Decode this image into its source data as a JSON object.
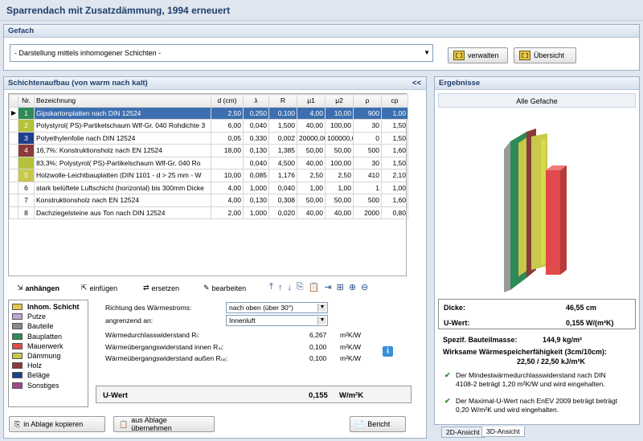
{
  "window": {
    "title": "Sparrendach mit Zusatzdämmung, 1994 erneuert"
  },
  "gefach": {
    "header": "Gefach",
    "dropdown_value": "- Darstellung mittels inhomogener Schichten -",
    "verwalten": "verwalten",
    "uebersicht": "Übersicht"
  },
  "schichten": {
    "header": "Schichtenaufbau (von warm nach kalt)",
    "collapse": "<<",
    "columns": [
      "Nr.",
      "Bezeichnung",
      "d (cm)",
      "λ",
      "R",
      "μ1",
      "μ2",
      "ρ",
      "cp"
    ],
    "rows": [
      {
        "nr": "1",
        "color": "#2e8b57",
        "name": "Gipskartonplatten nach DIN 12524",
        "d": "2,50",
        "l": "0,250",
        "r": "0,100",
        "m1": "4,00",
        "m2": "10,00",
        "rho": "900",
        "cp": "1,00"
      },
      {
        "nr": "2",
        "color": "#b5c23a",
        "name": "Polystyrol( PS)-Partikelschaum Wlf-Gr. 040 Rohdichte 3",
        "d": "6,00",
        "l": "0,040",
        "r": "1,500",
        "m1": "40,00",
        "m2": "100,00",
        "rho": "30",
        "cp": "1,50"
      },
      {
        "nr": "3",
        "color": "#1f3f8f",
        "name": "Polyethylenfolie nach DIN 12524",
        "d": "0,05",
        "l": "0,330",
        "r": "0,002",
        "m1": "20000,00",
        "m2": "100000,00",
        "rho": "0",
        "cp": "1,50"
      },
      {
        "nr": "4",
        "color": "#8b3a3a",
        "name": "16,7%: Konstruktionsholz nach EN 12524",
        "d": "18,00",
        "l": "0,130",
        "r": "1,385",
        "m1": "50,00",
        "m2": "50,00",
        "rho": "500",
        "cp": "1,60"
      },
      {
        "nr": "",
        "color": "#b5c23a",
        "name": "83,3%: Polystyrol( PS)-Partikelschaum Wlf-Gr. 040 Ro",
        "d": "",
        "l": "0,040",
        "r": "4,500",
        "m1": "40,00",
        "m2": "100,00",
        "rho": "30",
        "cp": "1,50"
      },
      {
        "nr": "5",
        "color": "#c8c84a",
        "name": "Holzwolle-Leichtbauplatten (DIN 1101 - d > 25 mm - W",
        "d": "10,00",
        "l": "0,085",
        "r": "1,176",
        "m1": "2,50",
        "m2": "2,50",
        "rho": "410",
        "cp": "2,10"
      },
      {
        "nr": "6",
        "color": "#ffffff",
        "name": "stark belüftete Luftschicht (horizontal) bis 300mm Dicke",
        "d": "4,00",
        "l": "1,000",
        "r": "0,040",
        "m1": "1,00",
        "m2": "1,00",
        "rho": "1",
        "cp": "1,00"
      },
      {
        "nr": "7",
        "color": "#ffffff",
        "name": "Konstruktionsholz nach EN 12524",
        "d": "4,00",
        "l": "0,130",
        "r": "0,308",
        "m1": "50,00",
        "m2": "50,00",
        "rho": "500",
        "cp": "1,60"
      },
      {
        "nr": "8",
        "color": "#ffffff",
        "name": "Dachziegelsteine aus Ton nach DIN 12524",
        "d": "2,00",
        "l": "1,000",
        "r": "0,020",
        "m1": "40,00",
        "m2": "40,00",
        "rho": "2000",
        "cp": "0,80"
      }
    ],
    "toolbar": {
      "anhaengen": "anhängen",
      "einfuegen": "einfügen",
      "ersetzen": "ersetzen",
      "bearbeiten": "bearbeiten"
    }
  },
  "legend": [
    {
      "label": "Inhom. Schicht",
      "color": "#e6c84a"
    },
    {
      "label": "Putze",
      "color": "#b9a8d8"
    },
    {
      "label": "Bauteile",
      "color": "#8a8a8a"
    },
    {
      "label": "Bauplatten",
      "color": "#2e8b57"
    },
    {
      "label": "Mauerwerk",
      "color": "#e04a4a"
    },
    {
      "label": "Dämmung",
      "color": "#c8c84a"
    },
    {
      "label": "Holz",
      "color": "#8b3a3a"
    },
    {
      "label": "Beläge",
      "color": "#1f3f8f"
    },
    {
      "label": "Sonstiges",
      "color": "#a04a8a"
    }
  ],
  "props": {
    "richtung_label": "Richtung des Wärmestroms:",
    "richtung_value": "nach oben (über 30°)",
    "angrenzend_label": "angrenzend an:",
    "angrenzend_value": "Innenluft",
    "rl_label": "Wärmedurchlasswiderstand Rₗ:",
    "rl_value": "6,267",
    "rl_unit": "m²K/W",
    "rsi_label": "Wärmeübergangswiderstand innen Rₛᵢ:",
    "rsi_value": "0,100",
    "rsi_unit": "m²K/W",
    "rse_label": "Wärmeübergangswiderstand außen Rₛₑ:",
    "rse_value": "0,100",
    "rse_unit": "m²K/W",
    "uwert_label": "U-Wert",
    "uwert_value": "0,155",
    "uwert_unit": "W/m²K"
  },
  "footer": {
    "kopieren": "in Ablage kopieren",
    "uebernehmen": "aus Ablage übernehmen",
    "bericht": "Bericht"
  },
  "ergebnisse": {
    "header": "Ergebnisse",
    "tab_header": "Alle Gefache",
    "dicke_label": "Dicke:",
    "dicke_value": "46,55 cm",
    "uwert_label": "U-Wert:",
    "uwert_value": "0,155 W/(m²K)",
    "masse_label": "Spezif. Bauteilmasse:",
    "masse_value": "144,9 kg/m²",
    "speicher_label": "Wirksame Wärmespeicherfähigkeit (3cm/10cm):",
    "speicher_value": "22,50 / 22,50 kJ/m²K",
    "check1": "Der Mindestwärmedurchlasswiderstand nach DIN 4108-2 beträgt 1,20 m²K/W und wird eingehalten.",
    "check2": "Der Maximal-U-Wert nach EnEV 2009 beträgt beträgt 0,20 W/m²K und wird eingehalten.",
    "tab2d": "2D-Ansicht",
    "tab3d": "3D-Ansicht"
  }
}
